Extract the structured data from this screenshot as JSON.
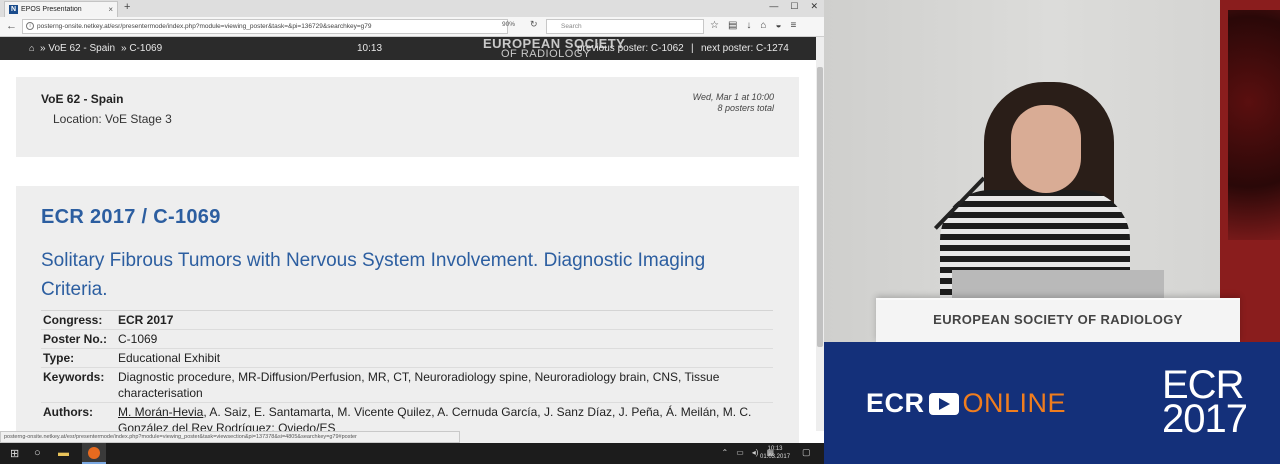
{
  "browser": {
    "tab_title": "EPOS Presentation",
    "tab_favicon": "N",
    "url": "posterng-onsite.netkey.at/esr/presentermode/index.php?module=viewing_poster&task=&pi=136729&searchkey=g79",
    "zoom": "90%",
    "search_placeholder": "Search"
  },
  "posterbar": {
    "crumb_session": "VoE 62 - Spain",
    "crumb_poster": "» C-1069",
    "time": "10:13",
    "logo_line1": "EUROPEAN SOCIETY",
    "logo_line2": "OF RADIOLOGY",
    "prev": "previous poster: C-1062",
    "sep": "|",
    "next": "next poster: C-1274"
  },
  "session": {
    "title": "VoE 62 - Spain",
    "location": "Location: VoE Stage 3",
    "date": "Wed, Mar 1 at 10:00",
    "count": "8 posters total"
  },
  "poster": {
    "id": "ECR 2017 / C-1069",
    "title": "Solitary Fibrous Tumors with Nervous System Involvement. Diagnostic Imaging Criteria.",
    "meta": {
      "congress_label": "Congress:",
      "congress": "ECR 2017",
      "number_label": "Poster No.:",
      "number": "C-1069",
      "type_label": "Type:",
      "type": "Educational Exhibit",
      "keywords_label": "Keywords:",
      "keywords": "Diagnostic procedure, MR-Diffusion/Perfusion, MR, CT, Neuroradiology spine, Neuroradiology brain, CNS, Tissue characterisation",
      "authors_label": "Authors:",
      "author_first": "M. Morán-Hevia",
      "authors_rest": ", A. Saiz, E. Santamarta, M. Vicente Quilez, A. Cernuda García, J. Sanz Díaz, J. Peña, Á. Meilán, M. C. González del Rey Rodríguez; Oviedo/ES"
    }
  },
  "statusbar_url": "posterng-onsite.netkey.at/esr/presentermode/index.php?module=viewing_poster&task=viewsection&pi=137378&si=4805&searchkey=g79#poster",
  "taskbar": {
    "clock_time": "10:13",
    "clock_date": "01.03.2017"
  },
  "video": {
    "lectern_text": "EUROPEAN SOCIETY OF RADIOLOGY"
  },
  "branding": {
    "ecr": "ECR",
    "online": "ONLINE",
    "year_line1": "ECR",
    "year_line2": "2017",
    "accent_color": "#f07d1e",
    "bg_color": "#14307a"
  }
}
